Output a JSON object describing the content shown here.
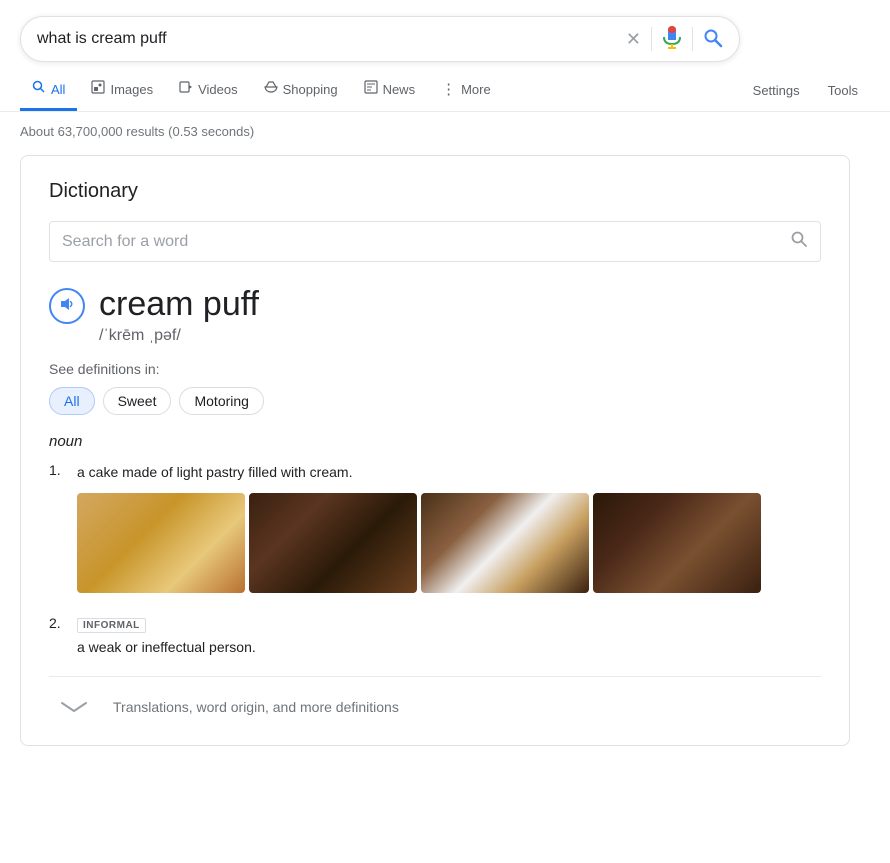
{
  "search": {
    "query": "what is cream puff",
    "placeholder": "Search for a word",
    "results_count": "About 63,700,000 results (0.53 seconds)"
  },
  "nav": {
    "tabs": [
      {
        "id": "all",
        "label": "All",
        "icon": "🔍",
        "active": true
      },
      {
        "id": "images",
        "label": "Images",
        "icon": "🖼"
      },
      {
        "id": "videos",
        "label": "Videos",
        "icon": "▶"
      },
      {
        "id": "shopping",
        "label": "Shopping",
        "icon": "◇"
      },
      {
        "id": "news",
        "label": "News",
        "icon": "▦"
      },
      {
        "id": "more",
        "label": "More",
        "icon": "⋮"
      }
    ],
    "settings": "Settings",
    "tools": "Tools"
  },
  "dictionary": {
    "title": "Dictionary",
    "word_search_placeholder": "Search for a word",
    "word": "cream puff",
    "pronunciation": "/ˈkrēm ˌpəf/",
    "see_defs_label": "See definitions in:",
    "tags": [
      {
        "label": "All",
        "active": true
      },
      {
        "label": "Sweet",
        "active": false
      },
      {
        "label": "Motoring",
        "active": false
      }
    ],
    "pos": "noun",
    "definitions": [
      {
        "num": "1.",
        "text": "a cake made of light pastry filled with cream.",
        "has_images": true
      },
      {
        "num": "2.",
        "badge": "INFORMAL",
        "text": "a weak or ineffectual person.",
        "has_images": false
      }
    ],
    "more_defs_label": "Translations, word origin, and more definitions"
  },
  "icons": {
    "close": "✕",
    "search": "🔍",
    "speaker": "🔊",
    "chevron_down": "∨"
  }
}
